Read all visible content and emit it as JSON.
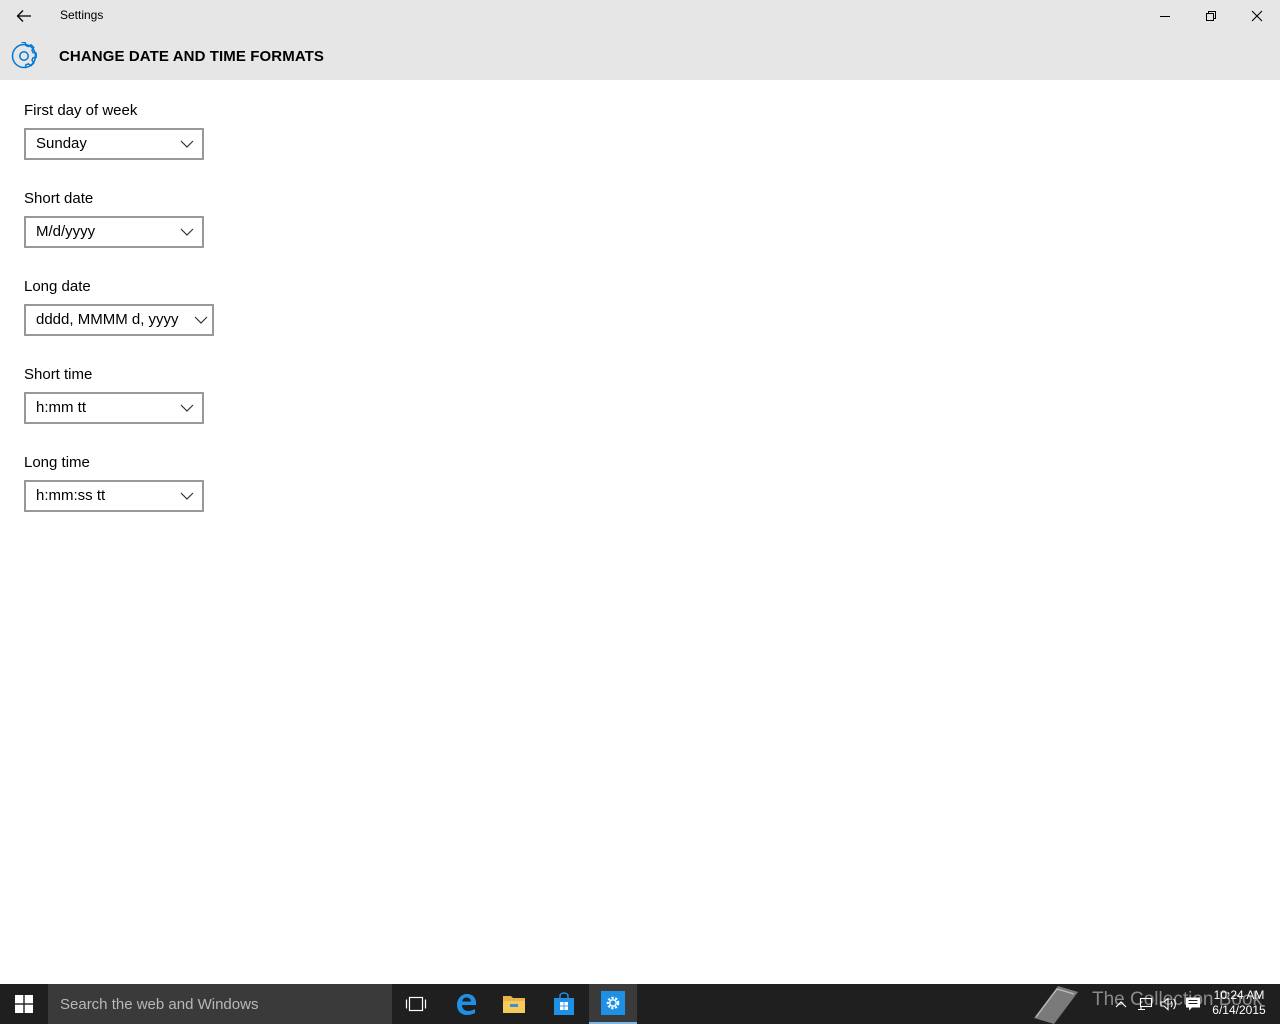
{
  "window": {
    "title": "Settings"
  },
  "header": {
    "title": "CHANGE DATE AND TIME FORMATS"
  },
  "fields": [
    {
      "label": "First day of week",
      "value": "Sunday"
    },
    {
      "label": "Short date",
      "value": "M/d/yyyy"
    },
    {
      "label": "Long date",
      "value": "dddd, MMMM d, yyyy"
    },
    {
      "label": "Short time",
      "value": "h:mm tt"
    },
    {
      "label": "Long time",
      "value": "h:mm:ss tt"
    }
  ],
  "taskbar": {
    "search_placeholder": "Search the web and Windows",
    "watermark": "The Collection Book",
    "clock_time": "10:24 AM",
    "clock_date": "6/14/2015",
    "icons": [
      "windows-logo-icon",
      "task-view-icon",
      "edge-icon",
      "file-explorer-icon",
      "store-icon",
      "settings-icon"
    ],
    "tray_icons": [
      "chevron-up-icon",
      "network-icon",
      "volume-icon",
      "action-center-icon"
    ]
  },
  "colors": {
    "accent": "#0078d7",
    "titlebar_bg": "#e6e6e6",
    "taskbar_bg": "#1f1f1f",
    "combo_border": "#999999"
  }
}
